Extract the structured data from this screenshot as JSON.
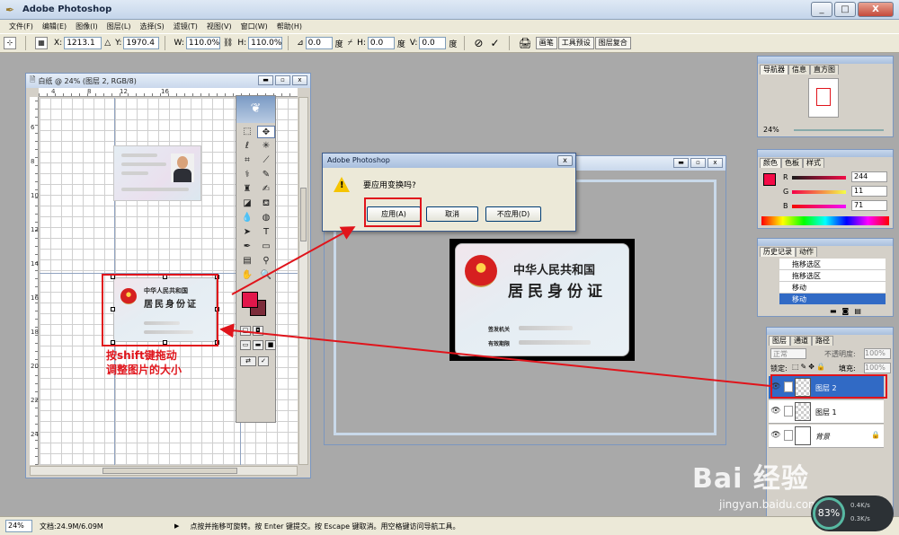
{
  "window": {
    "title": "Adobe Photoshop",
    "min": "_",
    "max": "□",
    "close": "X"
  },
  "menu": [
    "文件(F)",
    "编辑(E)",
    "图像(I)",
    "图层(L)",
    "选择(S)",
    "滤镜(T)",
    "视图(V)",
    "窗口(W)",
    "帮助(H)"
  ],
  "options": {
    "x_label": "X:",
    "x_value": "1213.1",
    "y_label": "Y:",
    "y_value": "1970.4",
    "w_label": "W:",
    "w_value": "110.0%",
    "h_label": "H:",
    "h_value": "110.0%",
    "angle_value": "0.0",
    "deg": "度",
    "hskew_label": "H:",
    "hskew_value": "0.0",
    "vskew_label": "V:",
    "vskew_value": "0.0",
    "cancel_icon": "⊘",
    "commit_icon": "✓",
    "palette_tabs": [
      "画笔",
      "工具预设",
      "图层复合"
    ]
  },
  "doc1": {
    "title": "白纸 @ 24% (图层 2, RGB/8)",
    "ruler_top": [
      "4",
      "8",
      "12",
      "16"
    ],
    "ruler_left": [
      "6",
      "8",
      "10",
      "12",
      "14",
      "16",
      "18",
      "20",
      "22",
      "24"
    ]
  },
  "small_card": {
    "country": "中华人民共和国",
    "title": "居民身份证"
  },
  "dialog": {
    "title": "Adobe Photoshop",
    "message": "要应用变换吗?",
    "apply": "应用(A)",
    "cancel": "取消",
    "dont_apply": "不应用(D)"
  },
  "doc2": {
    "country": "中华人民共和国",
    "title": "居民身份证",
    "issuer_label": "签发机关",
    "validity_label": "有效期限"
  },
  "annotation": {
    "line1": "按shift键拖动",
    "line2": "调整图片的大小"
  },
  "navigator": {
    "tabs": [
      "导航器",
      "信息",
      "直方图"
    ],
    "zoom": "24%"
  },
  "color": {
    "tabs": [
      "颜色",
      "色板",
      "样式"
    ],
    "r_label": "R",
    "r_value": "244",
    "g_label": "G",
    "g_value": "11",
    "b_label": "B",
    "b_value": "71",
    "fg_color": "#f40b47"
  },
  "history": {
    "tabs": [
      "历史记录",
      "动作"
    ],
    "items": [
      "拖移选区",
      "拖移选区",
      "移动",
      "移动"
    ]
  },
  "layers": {
    "tabs": [
      "图层",
      "通道",
      "路径"
    ],
    "blend_mode": "正常",
    "opacity_label": "不透明度:",
    "opacity_value": "100%",
    "lock_label": "锁定:",
    "fill_label": "填充:",
    "fill_value": "100%",
    "items": [
      "图层 2",
      "图层 1",
      "背景"
    ]
  },
  "status": {
    "zoom": "24%",
    "doc_size": "文档:24.9M/6.09M",
    "hint": "点按并拖移可旋转。按 Enter 键提交。按 Escape 键取消。用空格键访问导航工具。"
  },
  "watermark": {
    "brand": "Bai 经验",
    "url": "jingyan.baidu.com"
  },
  "net": {
    "percent": "83%",
    "up": "0.4K/s",
    "down": "0.3K/s"
  }
}
